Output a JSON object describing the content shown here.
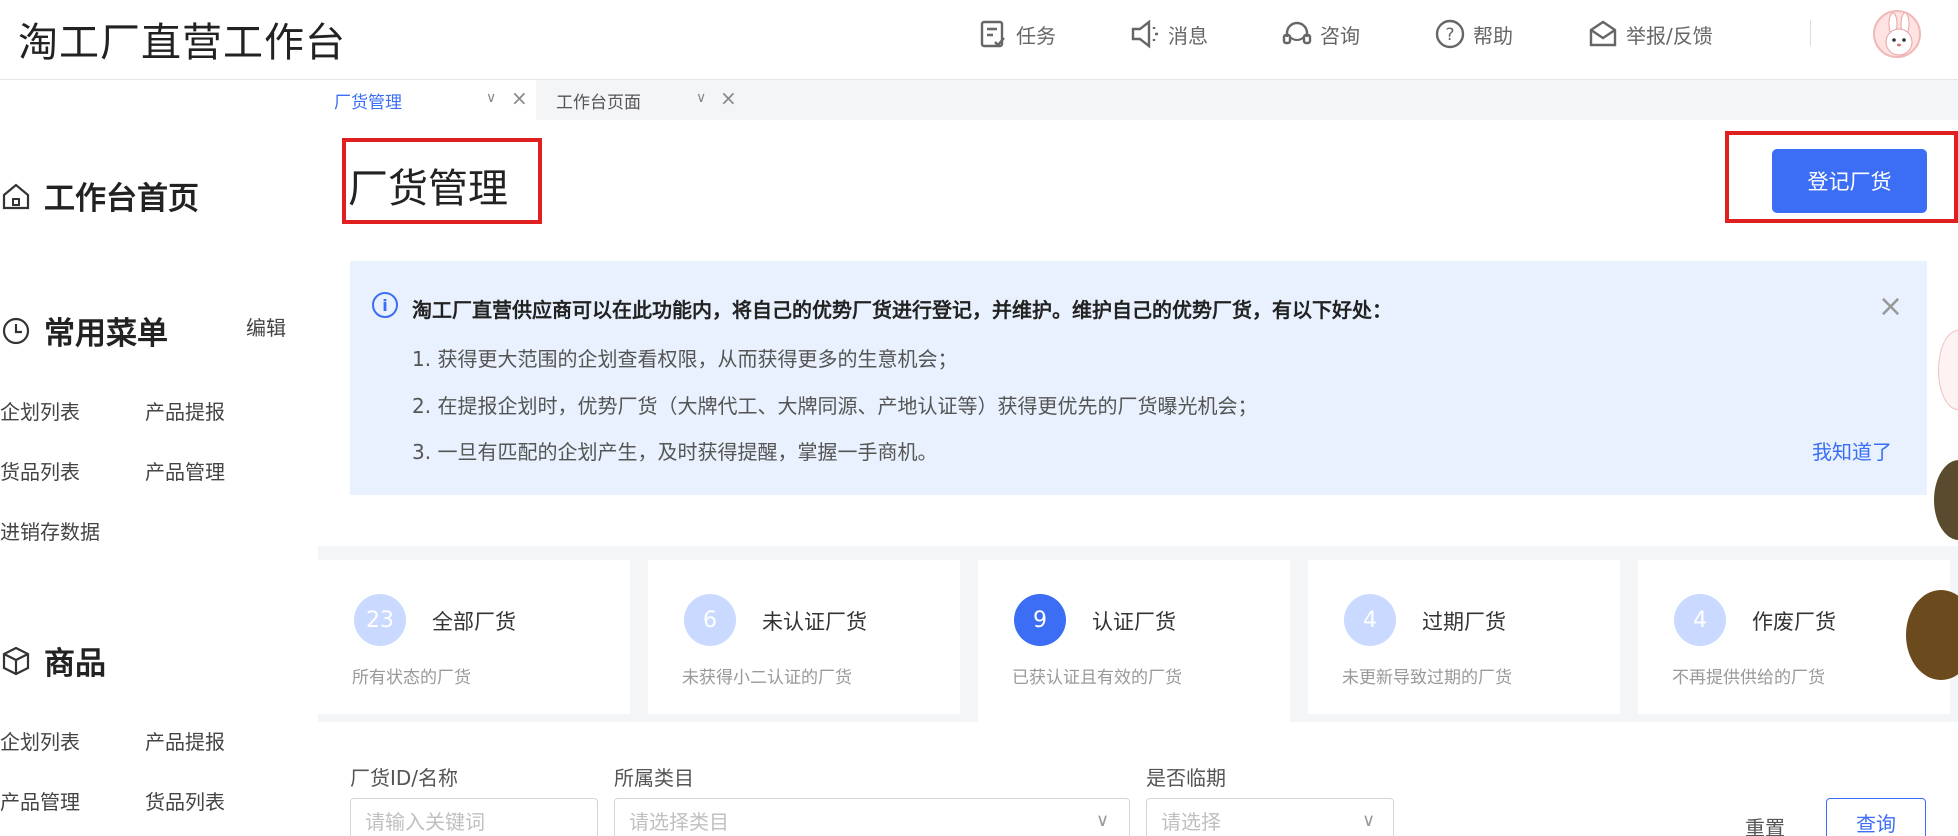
{
  "header": {
    "title": "淘工厂直营工作台",
    "nav": [
      {
        "label": "任务",
        "icon": "task-icon"
      },
      {
        "label": "消息",
        "icon": "speaker-icon"
      },
      {
        "label": "咨询",
        "icon": "headset-icon"
      },
      {
        "label": "帮助",
        "icon": "help-icon"
      },
      {
        "label": "举报/反馈",
        "icon": "feedback-icon"
      }
    ]
  },
  "sidebar": {
    "home": "工作台首页",
    "common": {
      "title": "常用菜单",
      "edit": "编辑",
      "links": [
        "企划列表",
        "产品提报",
        "货品列表",
        "产品管理",
        "进销存数据"
      ]
    },
    "goods": {
      "title": "商品",
      "links": [
        "企划列表",
        "产品提报",
        "产品管理",
        "货品列表"
      ]
    }
  },
  "tabs": [
    {
      "label": "厂货管理",
      "active": true
    },
    {
      "label": "工作台页面",
      "active": false
    }
  ],
  "page": {
    "title": "厂货管理",
    "register_button": "登记厂货"
  },
  "notice": {
    "heading": "淘工厂直营供应商可以在此功能内，将自己的优势厂货进行登记，并维护。维护自己的优势厂货，有以下好处：",
    "lines": [
      "1. 获得更大范围的企划查看权限，从而获得更多的生意机会；",
      "2. 在提报企划时，优势厂货（大牌代工、大牌同源、产地认证等）获得更优先的厂货曝光机会；",
      "3. 一旦有匹配的企划产生，及时获得提醒，掌握一手商机。"
    ],
    "ack": "我知道了"
  },
  "stats": [
    {
      "count": "23",
      "name": "全部厂货",
      "desc": "所有状态的厂货",
      "active": false
    },
    {
      "count": "6",
      "name": "未认证厂货",
      "desc": "未获得小二认证的厂货",
      "active": false
    },
    {
      "count": "9",
      "name": "认证厂货",
      "desc": "已获认证且有效的厂货",
      "active": true
    },
    {
      "count": "4",
      "name": "过期厂货",
      "desc": "未更新导致过期的厂货",
      "active": false
    },
    {
      "count": "4",
      "name": "作废厂货",
      "desc": "不再提供供给的厂货",
      "active": false
    }
  ],
  "filters": {
    "id_label": "厂货ID/名称",
    "id_placeholder": "请输入关键词",
    "category_label": "所属类目",
    "category_placeholder": "请选择类目",
    "expiry_label": "是否临期",
    "expiry_placeholder": "请选择",
    "reset": "重置",
    "query": "查询"
  },
  "colors": {
    "accent": "#3b6ef5",
    "highlight": "#e02020",
    "notice_bg": "#e8f1fd"
  }
}
